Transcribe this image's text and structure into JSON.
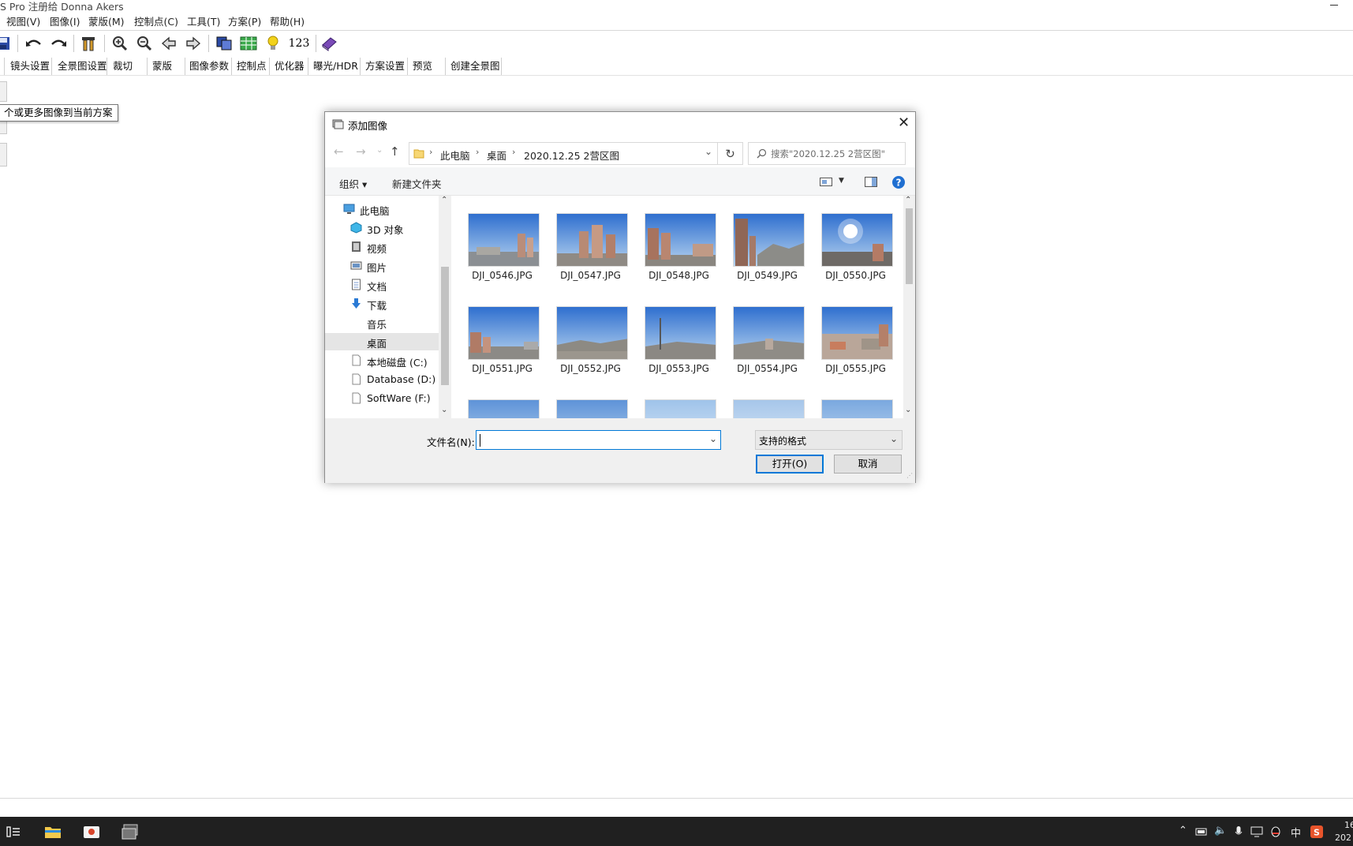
{
  "app": {
    "title": "S Pro 注册给 Donna Akers"
  },
  "menubar": {
    "items": [
      "视图(V)",
      "图像(I)",
      "蒙版(M)",
      "控制点(C)",
      "工具(T)",
      "方案(P)",
      "帮助(H)"
    ]
  },
  "toolbar": {
    "number_button": "123"
  },
  "tabs": [
    "镜头设置",
    "全景图设置",
    "裁切",
    "蒙版",
    "图像参数",
    "控制点",
    "优化器",
    "曝光/HDR",
    "方案设置",
    "预览",
    "创建全景图"
  ],
  "tooltip": "个或更多图像到当前方案",
  "dialog": {
    "title": "添加图像",
    "breadcrumb": [
      "此电脑",
      "桌面",
      "2020.12.25 2营区图"
    ],
    "search_placeholder": "搜索\"2020.12.25 2营区图\"",
    "organize": "组织 ▾",
    "new_folder": "新建文件夹",
    "nav": [
      {
        "label": "此电脑",
        "icon": "computer-icon"
      },
      {
        "label": "3D 对象",
        "icon": "3d-objects-icon"
      },
      {
        "label": "视频",
        "icon": "video-icon"
      },
      {
        "label": "图片",
        "icon": "pictures-icon"
      },
      {
        "label": "文档",
        "icon": "documents-icon"
      },
      {
        "label": "下载",
        "icon": "download-icon"
      },
      {
        "label": "音乐",
        "icon": "music-icon"
      },
      {
        "label": "桌面",
        "icon": "desktop-icon",
        "selected": true
      },
      {
        "label": "本地磁盘 (C:)",
        "icon": "drive-icon"
      },
      {
        "label": "Database (D:)",
        "icon": "drive-icon"
      },
      {
        "label": "SoftWare (F:)",
        "icon": "drive-icon"
      }
    ],
    "files": [
      "DJI_0546.JPG",
      "DJI_0547.JPG",
      "DJI_0548.JPG",
      "DJI_0549.JPG",
      "DJI_0550.JPG",
      "DJI_0551.JPG",
      "DJI_0552.JPG",
      "DJI_0553.JPG",
      "DJI_0554.JPG",
      "DJI_0555.JPG"
    ],
    "filename_label": "文件名(N):",
    "filename_value": "",
    "filetype": "支持的格式",
    "open_button": "打开(O)",
    "cancel_button": "取消"
  },
  "taskbar": {
    "ime": "中",
    "clock_time": "16",
    "clock_date": "202"
  }
}
